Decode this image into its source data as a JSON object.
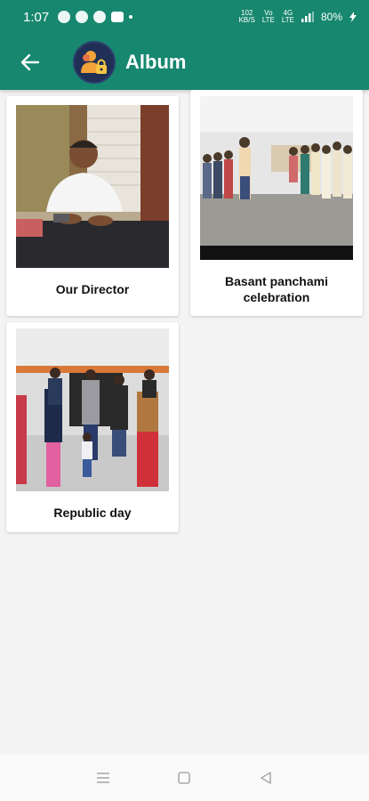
{
  "status_bar": {
    "time": "1:07",
    "speed_value": "102",
    "speed_unit": "KB/S",
    "network_top": "Vo",
    "network_bottom": "LTE",
    "net_label_top": "4G",
    "net_label_bottom": "LTE",
    "battery": "80%"
  },
  "app_bar": {
    "title": "Album",
    "back_icon": "arrow-left-icon",
    "logo_icon": "people-lock-logo"
  },
  "albums": [
    {
      "caption": "Our Director",
      "photo": "director-photo"
    },
    {
      "caption": "Basant panchami celebration",
      "photo": "basant-panchami-photo"
    },
    {
      "caption": "Republic day",
      "photo": "republic-day-photo"
    }
  ],
  "nav_bar": {
    "menu_icon": "menu-lines-icon",
    "home_icon": "square-home-icon",
    "back_icon": "triangle-back-icon"
  },
  "colors": {
    "primary": "#17876f",
    "background": "#f4f4f4"
  }
}
